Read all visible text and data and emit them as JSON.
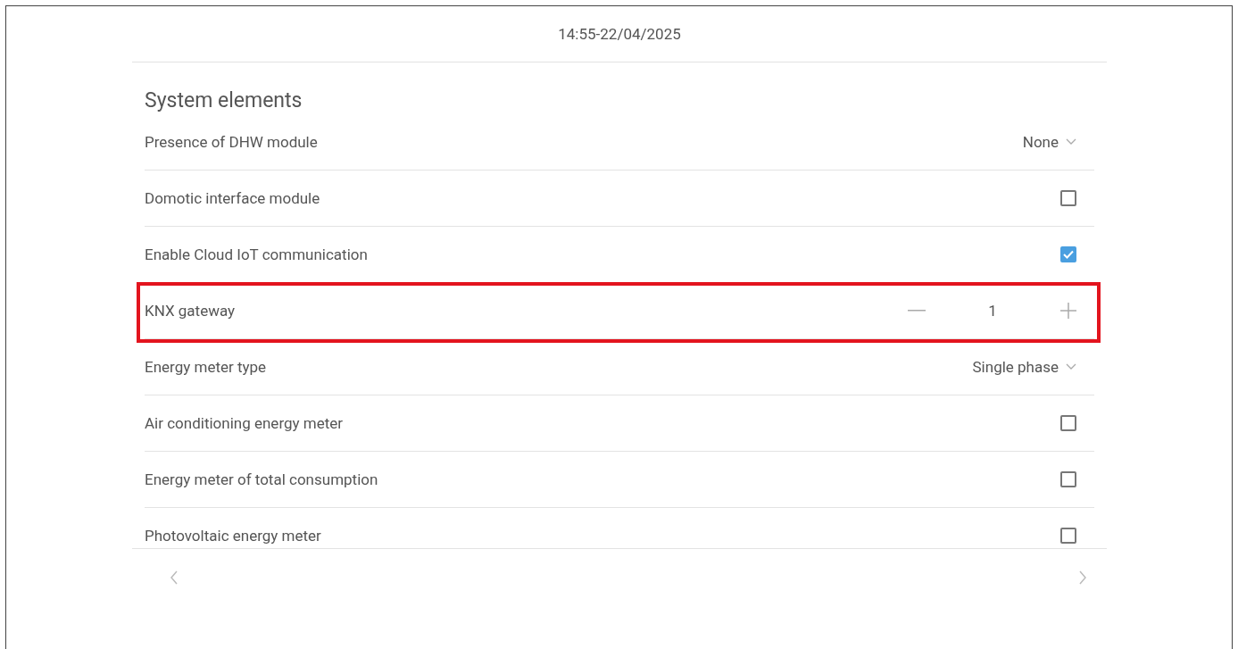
{
  "header": {
    "datetime": "14:55-22/04/2025"
  },
  "section": {
    "title": "System elements"
  },
  "rows": [
    {
      "kind": "dropdown",
      "label": "Presence of DHW module",
      "value": "None",
      "highlighted": false
    },
    {
      "kind": "checkbox",
      "label": "Domotic interface module",
      "checked": false,
      "highlighted": false
    },
    {
      "kind": "checkbox",
      "label": "Enable Cloud IoT communication",
      "checked": true,
      "highlighted": false
    },
    {
      "kind": "stepper",
      "label": "KNX gateway",
      "value": "1",
      "highlighted": true
    },
    {
      "kind": "dropdown",
      "label": "Energy meter type",
      "value": "Single phase",
      "highlighted": false
    },
    {
      "kind": "checkbox",
      "label": "Air conditioning energy meter",
      "checked": false,
      "highlighted": false
    },
    {
      "kind": "checkbox",
      "label": "Energy meter of total consumption",
      "checked": false,
      "highlighted": false
    },
    {
      "kind": "checkbox",
      "label": "Photovoltaic energy meter",
      "checked": false,
      "highlighted": false
    }
  ]
}
